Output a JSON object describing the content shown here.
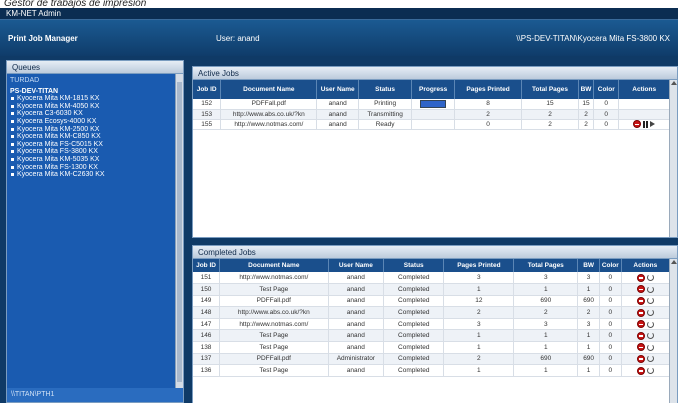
{
  "caption": "Gestor de trabajos de impresión",
  "window": {
    "title": "KM-NET Admin"
  },
  "header": {
    "app_title": "Print Job Manager",
    "user": "User: anand",
    "device": "\\\\PS-DEV-TITAN\\Kyocera Mita FS-3800 KX"
  },
  "queues": {
    "title": "Queues",
    "label": "TURDAD",
    "group": "PS-DEV-TITAN",
    "items": [
      "Kyocera Mita KM-1815 KX",
      "Kyocera Mita KM-4050 KX",
      "Kyocera C3-6030 KX",
      "Kyocera Ecosys-4000 KX",
      "Kyocera Mita KM-2500 KX",
      "Kyocera Mita KM-C850 KX",
      "Kyocera Mita FS-C5015 KX",
      "Kyocera Mita FS-3800 KX",
      "Kyocera Mita KM-5035 KX",
      "Kyocera Mita FS-1300 KX",
      "Kyocera Mita KM-C2630 KX"
    ],
    "footer": "\\\\TITAN\\PTH1"
  },
  "active_jobs": {
    "title": "Active Jobs",
    "columns": [
      "Job ID",
      "Document Name",
      "User Name",
      "Status",
      "Progress",
      "Pages Printed",
      "Total Pages",
      "BW",
      "Color",
      "Actions"
    ],
    "rows": [
      {
        "id": "152",
        "doc": "PDFFall.pdf",
        "user": "anand",
        "status": "Printing",
        "progress": 1.0,
        "printed": "8",
        "total": "15",
        "bw": "15",
        "color": "0"
      },
      {
        "id": "153",
        "doc": "http://www.abs.co.uk/?kn",
        "user": "anand",
        "status": "Transmitting",
        "progress": null,
        "printed": "2",
        "total": "2",
        "bw": "2",
        "color": "0"
      },
      {
        "id": "155",
        "doc": "http://www.notmas.com/",
        "user": "anand",
        "status": "Ready",
        "progress": null,
        "printed": "0",
        "total": "2",
        "bw": "2",
        "color": "0"
      }
    ]
  },
  "completed_jobs": {
    "title": "Completed Jobs",
    "columns": [
      "Job ID",
      "Document Name",
      "User Name",
      "Status",
      "Pages Printed",
      "Total Pages",
      "BW",
      "Color",
      "Actions"
    ],
    "rows": [
      {
        "id": "151",
        "doc": "http://www.notmas.com/",
        "user": "anand",
        "status": "Completed",
        "printed": "3",
        "total": "3",
        "bw": "3",
        "color": "0"
      },
      {
        "id": "150",
        "doc": "Test Page",
        "user": "anand",
        "status": "Completed",
        "printed": "1",
        "total": "1",
        "bw": "1",
        "color": "0"
      },
      {
        "id": "149",
        "doc": "PDFFall.pdf",
        "user": "anand",
        "status": "Completed",
        "printed": "12",
        "total": "690",
        "bw": "690",
        "color": "0"
      },
      {
        "id": "148",
        "doc": "http://www.abs.co.uk/?kn",
        "user": "anand",
        "status": "Completed",
        "printed": "2",
        "total": "2",
        "bw": "2",
        "color": "0"
      },
      {
        "id": "147",
        "doc": "http://www.notmas.com/",
        "user": "anand",
        "status": "Completed",
        "printed": "3",
        "total": "3",
        "bw": "3",
        "color": "0"
      },
      {
        "id": "146",
        "doc": "Test Page",
        "user": "anand",
        "status": "Completed",
        "printed": "1",
        "total": "1",
        "bw": "1",
        "color": "0"
      },
      {
        "id": "138",
        "doc": "Test Page",
        "user": "anand",
        "status": "Completed",
        "printed": "1",
        "total": "1",
        "bw": "1",
        "color": "0"
      },
      {
        "id": "137",
        "doc": "PDFFall.pdf",
        "user": "Administrator",
        "status": "Completed",
        "printed": "2",
        "total": "690",
        "bw": "690",
        "color": "0"
      },
      {
        "id": "136",
        "doc": "Test Page",
        "user": "anand",
        "status": "Completed",
        "printed": "1",
        "total": "1",
        "bw": "1",
        "color": "0"
      }
    ]
  },
  "colors": {
    "accent": "#1a4f8c",
    "header": "#0f3c6a",
    "queue_bg": "#1a5bb0",
    "cancel": "#c81414"
  },
  "icons": {
    "cancel": "cancel-icon",
    "pause": "pause-icon",
    "resume": "resume-icon",
    "reprint": "reprint-icon"
  }
}
